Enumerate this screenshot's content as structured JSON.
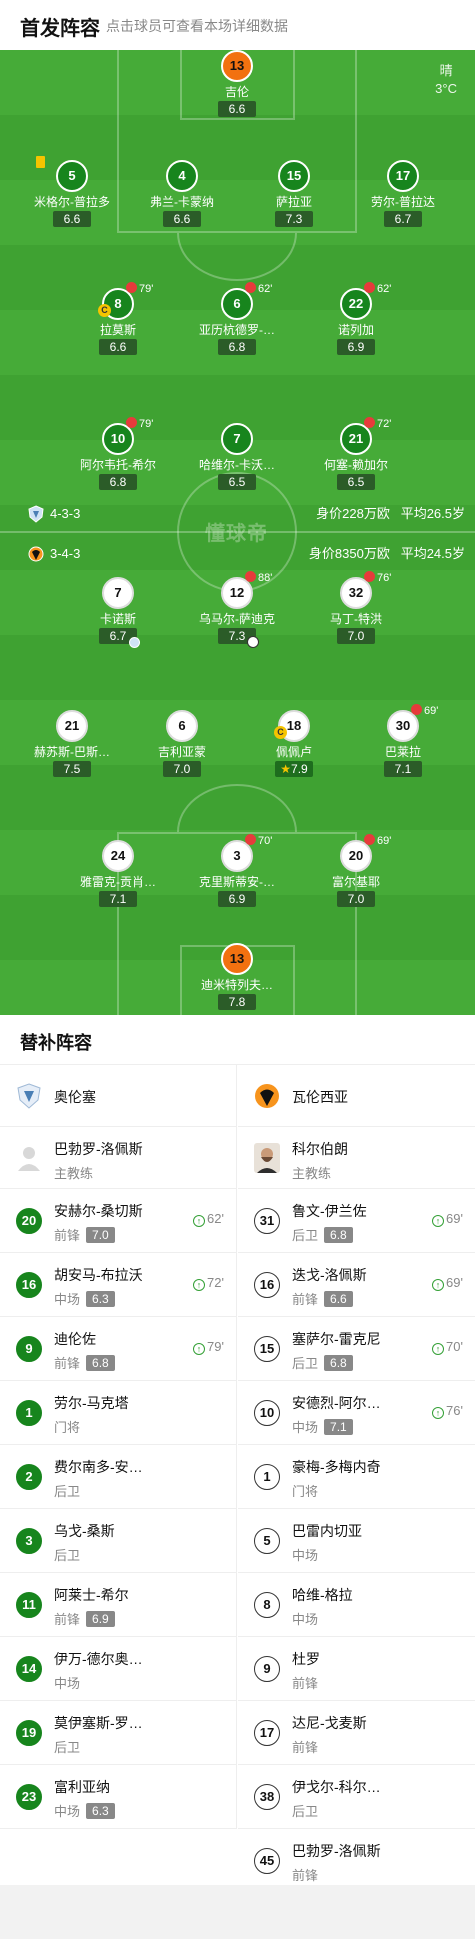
{
  "header": {
    "title": "首发阵容",
    "subtitle": "点击球员可查看本场详细数据"
  },
  "weather": {
    "condition": "晴",
    "temp": "3°C"
  },
  "watermark": "懂球帝",
  "home_info": {
    "formation": "4-3-3",
    "value": "身价228万欧",
    "age": "平均26.5岁"
  },
  "away_info": {
    "formation": "3-4-3",
    "value": "身价8350万欧",
    "age": "平均24.5岁"
  },
  "home_players": [
    {
      "num": "13",
      "name": "吉伦",
      "rating": "6.6",
      "gk": true
    },
    {
      "num": "5",
      "name": "米格尔-普拉多",
      "rating": "6.6",
      "yellow": true
    },
    {
      "num": "4",
      "name": "弗兰-卡蒙纳",
      "rating": "6.6"
    },
    {
      "num": "15",
      "name": "萨拉亚",
      "rating": "7.3"
    },
    {
      "num": "17",
      "name": "劳尔-普拉达",
      "rating": "6.7"
    },
    {
      "num": "8",
      "name": "拉莫斯",
      "rating": "6.6",
      "sub": "79'",
      "captain": true
    },
    {
      "num": "6",
      "name": "亚历杭德罗-…",
      "rating": "6.8",
      "sub": "62'"
    },
    {
      "num": "22",
      "name": "诺列加",
      "rating": "6.9",
      "sub": "62'"
    },
    {
      "num": "10",
      "name": "阿尔韦托-希尔",
      "rating": "6.8",
      "sub": "79'"
    },
    {
      "num": "7",
      "name": "哈维尔-卡沃…",
      "rating": "6.5"
    },
    {
      "num": "21",
      "name": "何塞-赖加尔",
      "rating": "6.5",
      "sub": "72'"
    }
  ],
  "away_players": [
    {
      "num": "7",
      "name": "卡诺斯",
      "rating": "6.7",
      "assist": true
    },
    {
      "num": "12",
      "name": "乌马尔-萨迪克",
      "rating": "7.3",
      "sub": "88'",
      "goal": true
    },
    {
      "num": "32",
      "name": "马丁-特洪",
      "rating": "7.0",
      "sub": "76'"
    },
    {
      "num": "21",
      "name": "赫苏斯-巴斯…",
      "rating": "7.5"
    },
    {
      "num": "6",
      "name": "吉利亚蒙",
      "rating": "7.0"
    },
    {
      "num": "18",
      "name": "佩佩卢",
      "rating": "7.9",
      "captain": true,
      "star": true
    },
    {
      "num": "30",
      "name": "巴莱拉",
      "rating": "7.1",
      "sub": "69'"
    },
    {
      "num": "24",
      "name": "雅雷克-贡肖…",
      "rating": "7.1"
    },
    {
      "num": "3",
      "name": "克里斯蒂安-…",
      "rating": "6.9",
      "sub": "70'"
    },
    {
      "num": "20",
      "name": "富尔基耶",
      "rating": "7.0",
      "sub": "69'"
    },
    {
      "num": "13",
      "name": "迪米特列夫…",
      "rating": "7.8",
      "gk": true
    }
  ],
  "bench": {
    "title": "替补阵容",
    "home": {
      "team": "奥伦塞",
      "coach": {
        "name": "巴勃罗-洛佩斯",
        "role": "主教练"
      },
      "subs": [
        {
          "num": "20",
          "name": "安赫尔-桑切斯",
          "pos": "前锋",
          "rating": "7.0",
          "time": "62'"
        },
        {
          "num": "16",
          "name": "胡安马-布拉沃",
          "pos": "中场",
          "rating": "6.3",
          "time": "72'"
        },
        {
          "num": "9",
          "name": "迪伦佐",
          "pos": "前锋",
          "rating": "6.8",
          "time": "79'"
        },
        {
          "num": "1",
          "name": "劳尔-马克塔",
          "pos": "门将"
        },
        {
          "num": "2",
          "name": "费尔南多-安…",
          "pos": "后卫"
        },
        {
          "num": "3",
          "name": "乌戈-桑斯",
          "pos": "后卫"
        },
        {
          "num": "11",
          "name": "阿莱士-希尔",
          "pos": "前锋",
          "rating": "6.9"
        },
        {
          "num": "14",
          "name": "伊万-德尔奥…",
          "pos": "中场"
        },
        {
          "num": "19",
          "name": "莫伊塞斯-罗…",
          "pos": "后卫"
        },
        {
          "num": "23",
          "name": "富利亚纳",
          "pos": "中场",
          "rating": "6.3"
        }
      ]
    },
    "away": {
      "team": "瓦伦西亚",
      "coach": {
        "name": "科尔伯朗",
        "role": "主教练"
      },
      "subs": [
        {
          "num": "31",
          "name": "鲁文-伊兰佐",
          "pos": "后卫",
          "rating": "6.8",
          "time": "69'"
        },
        {
          "num": "16",
          "name": "迭戈-洛佩斯",
          "pos": "前锋",
          "rating": "6.6",
          "time": "69'"
        },
        {
          "num": "15",
          "name": "塞萨尔-雷克尼",
          "pos": "后卫",
          "rating": "6.8",
          "time": "70'"
        },
        {
          "num": "10",
          "name": "安德烈-阿尔…",
          "pos": "中场",
          "rating": "7.1",
          "time": "76'"
        },
        {
          "num": "1",
          "name": "豪梅-多梅内奇",
          "pos": "门将"
        },
        {
          "num": "5",
          "name": "巴雷内切亚",
          "pos": "中场"
        },
        {
          "num": "8",
          "name": "哈维-格拉",
          "pos": "中场"
        },
        {
          "num": "9",
          "name": "杜罗",
          "pos": "前锋"
        },
        {
          "num": "17",
          "name": "达尼-戈麦斯",
          "pos": "前锋"
        },
        {
          "num": "38",
          "name": "伊戈尔-科尔…",
          "pos": "后卫"
        },
        {
          "num": "45",
          "name": "巴勃罗-洛佩斯",
          "pos": "前锋"
        }
      ]
    }
  },
  "colors": {
    "pitch": "#46ab38",
    "home": "#17851d",
    "gk": "#f27110",
    "sub_arrow": "#e63b3b"
  }
}
